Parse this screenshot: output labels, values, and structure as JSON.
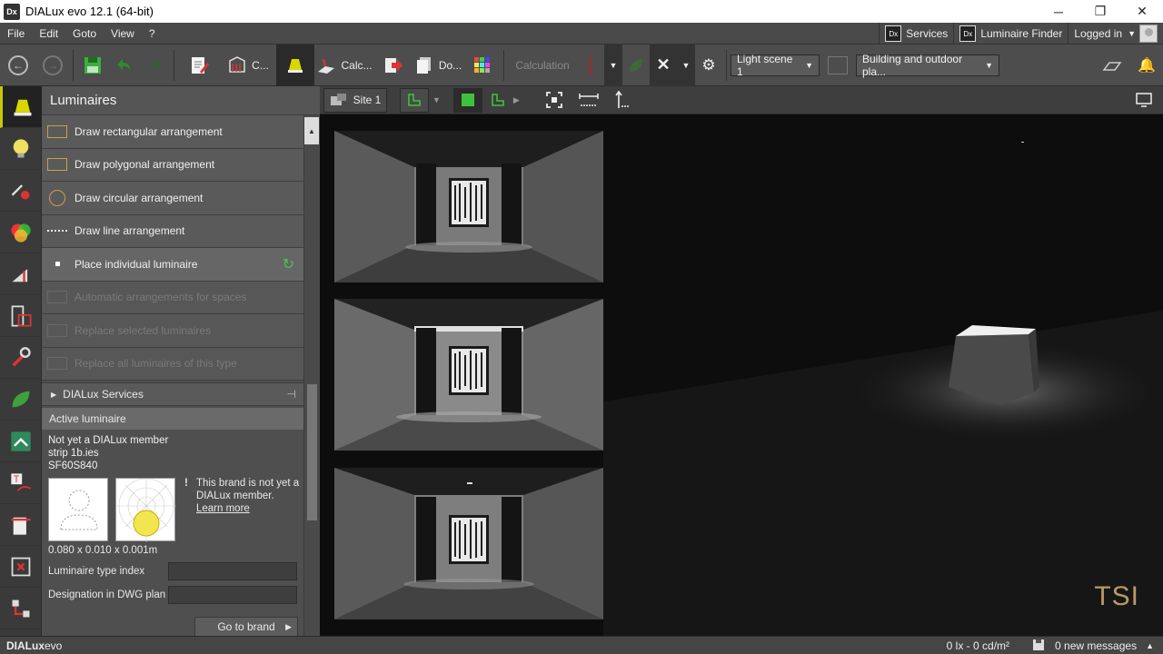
{
  "window": {
    "app_icon_text": "Dx",
    "title": "DIALux evo 12.1  (64-bit)",
    "minimize_glyph": "─",
    "restore_glyph": "❐",
    "close_glyph": "✕"
  },
  "menu": {
    "items": [
      "File",
      "Edit",
      "Goto",
      "View",
      "?"
    ],
    "services_label": "Services",
    "luminaire_finder_label": "Luminaire Finder",
    "logged_in_label": "Logged in",
    "badge_text": "Dx"
  },
  "toolbar": {
    "construction_label": "C...",
    "calculation_short_label": "Calc...",
    "documentation_label": "Do...",
    "calculation_label": "Calculation",
    "light_scene": "Light scene 1",
    "planning_mode": "Building and outdoor pla...",
    "back_glyph": "←",
    "forward_glyph": "→"
  },
  "side_panel": {
    "title": "Luminaires",
    "tools": [
      {
        "label": "Draw rectangular arrangement"
      },
      {
        "label": "Draw polygonal arrangement"
      },
      {
        "label": "Draw circular arrangement"
      },
      {
        "label": "Draw line arrangement"
      },
      {
        "label": "Place individual luminaire"
      },
      {
        "label": "Automatic arrangements for spaces"
      },
      {
        "label": "Replace selected luminaires"
      },
      {
        "label": "Replace all luminaires of this type"
      }
    ],
    "services_label": "DIALux Services",
    "active_luminaire_label": "Active luminaire",
    "luminaire": {
      "member_status": "Not yet a DIALux member",
      "file": "strip 1b.ies",
      "code": "SF60S840",
      "dimensions": "0.080 x 0.010 x 0.001m"
    },
    "brand_note": "This brand is not yet a DIALux member.",
    "learn_more": "Learn more",
    "fields": {
      "type_index_label": "Luminaire type index",
      "dwg_label": "Designation in DWG plan"
    },
    "goto_brand": "Go to brand"
  },
  "viewport": {
    "site_label": "Site 1",
    "watermark": "TSI"
  },
  "status": {
    "brand_bold": "DIALux",
    "brand_rest": "evo",
    "illuminance": "0 lx - 0 cd/m²",
    "messages": "0 new messages"
  },
  "colors": {
    "accent_yellow": "#c8c800",
    "green_active": "#3ec23e",
    "orange_tool": "#c8a050"
  }
}
